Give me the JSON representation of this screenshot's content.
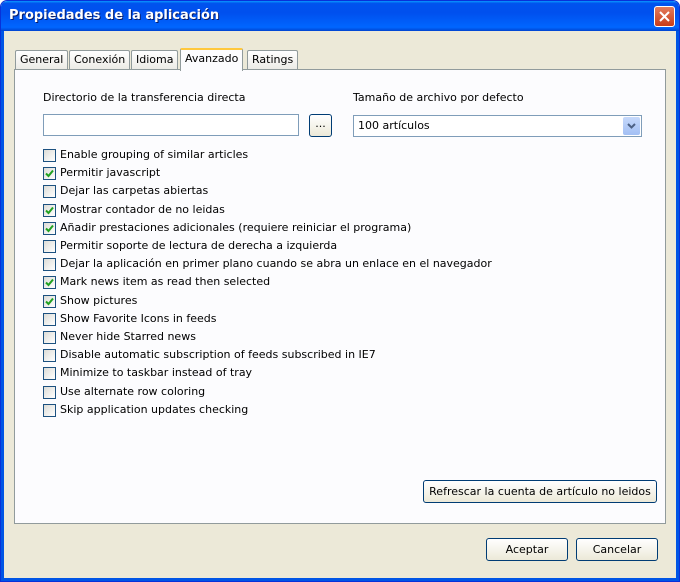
{
  "window": {
    "title": "Propiedades de la aplicación"
  },
  "tabs": [
    {
      "label": "General"
    },
    {
      "label": "Conexión"
    },
    {
      "label": "Idioma"
    },
    {
      "label": "Avanzado",
      "active": true
    },
    {
      "label": "Ratings"
    }
  ],
  "advanced": {
    "download_dir_label": "Directorio de la transferencia directa",
    "download_dir_value": "",
    "browse_label": "...",
    "file_size_label": "Tamaño de archivo por defecto",
    "file_size_value": "100 artículos",
    "options": [
      {
        "label": "Enable grouping of similar articles",
        "checked": false
      },
      {
        "label": "Permitir javascript",
        "checked": true
      },
      {
        "label": "Dejar las carpetas abiertas",
        "checked": false
      },
      {
        "label": "Mostrar contador de no leidas",
        "checked": true
      },
      {
        "label": "Añadir prestaciones adicionales (requiere reiniciar el programa)",
        "checked": true
      },
      {
        "label": "Permitir soporte de lectura de derecha a izquierda",
        "checked": false
      },
      {
        "label": "Dejar la aplicación en primer plano cuando se abra un enlace en el navegador",
        "checked": false
      },
      {
        "label": "Mark news item as read then selected",
        "checked": true
      },
      {
        "label": "Show pictures",
        "checked": true
      },
      {
        "label": "Show Favorite Icons in feeds",
        "checked": false
      },
      {
        "label": "Never hide Starred news",
        "checked": false
      },
      {
        "label": "Disable automatic subscription of feeds subscribed in IE7",
        "checked": false
      },
      {
        "label": "Minimize to taskbar instead of tray",
        "checked": false
      },
      {
        "label": "Use alternate row coloring",
        "checked": false
      },
      {
        "label": "Skip application updates checking",
        "checked": false
      }
    ],
    "refresh_label": "Refrescar la cuenta de artículo no leidos"
  },
  "footer": {
    "ok_label": "Aceptar",
    "cancel_label": "Cancelar"
  },
  "colors": {
    "titlebar": "#0054e3",
    "dialog_bg": "#ece9d8",
    "panel_bg": "#fcfcfe",
    "check": "#21a121"
  }
}
